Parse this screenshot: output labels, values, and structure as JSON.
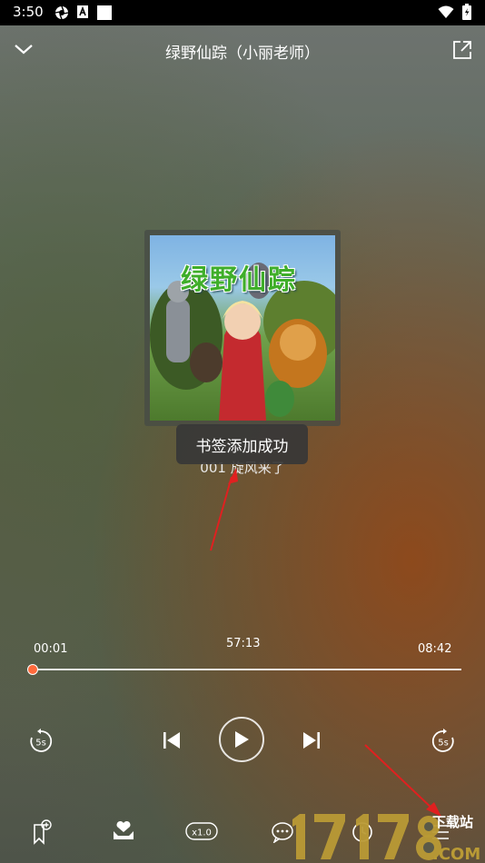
{
  "status_bar": {
    "time": "3:50"
  },
  "header": {
    "title": "绿野仙踪（小丽老师）"
  },
  "cover": {
    "title": "绿野仙踪"
  },
  "toast": {
    "message": "书签添加成功"
  },
  "track": {
    "title": "001 旋风来了"
  },
  "player": {
    "elapsed": "00:01",
    "countdown": "57:13",
    "duration": "08:42",
    "progress": 0.02,
    "skip_back_label": "5s",
    "skip_forward_label": "5s"
  },
  "bottom_bar": {
    "speed_label": "x1.0"
  },
  "colors": {
    "accent": "#ff6a3c",
    "annotation": "#e02020"
  },
  "watermark": {
    "number": "17178",
    "site": "下载站",
    "domain": ".COM"
  }
}
